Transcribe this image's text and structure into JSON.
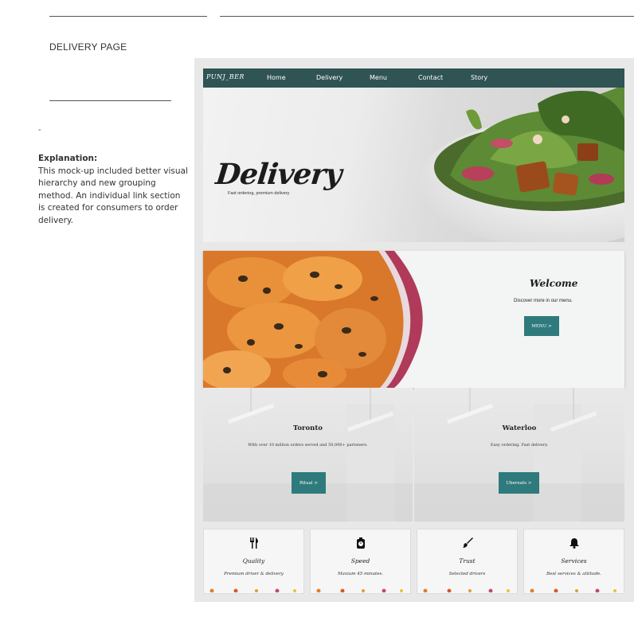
{
  "page_label": "DELIVERY PAGE",
  "dash": "-",
  "explanation": {
    "heading": "Explanation:",
    "body": "This mock-up included better visual hierarchy and new grouping method. An individual link section is created for consumers to order delivery."
  },
  "navbar": {
    "logo": "PUNJ_BER",
    "items": [
      "Home",
      "Delivery",
      "Menu",
      "Contact",
      "Story"
    ]
  },
  "hero": {
    "title": "Delivery",
    "subtitle": "Fast ordering, premium delivery"
  },
  "welcome": {
    "title": "Welcome",
    "subtitle": "Discover more in our menu.",
    "button": "MENU >"
  },
  "cities": [
    {
      "title": "Toronto",
      "subtitle": "With over 10 million orders served and 50,000+ parteners.",
      "button": "Ritual >"
    },
    {
      "title": "Waterloo",
      "subtitle": "Easy ordering. Fast delivery.",
      "button": "Ubereats >"
    }
  ],
  "features": [
    {
      "icon": "utensils-icon",
      "title": "Quality",
      "subtitle": "Premium driver & delivery"
    },
    {
      "icon": "timer-icon",
      "title": "Speed",
      "subtitle": "Maxium 45 minutes."
    },
    {
      "icon": "brush-icon",
      "title": "Trust",
      "subtitle": "Selected drivers"
    },
    {
      "icon": "bell-icon",
      "title": "Services",
      "subtitle": "Best services & attitude."
    }
  ],
  "colors": {
    "navbar": "#2f5453",
    "button": "#2f7a7d"
  }
}
